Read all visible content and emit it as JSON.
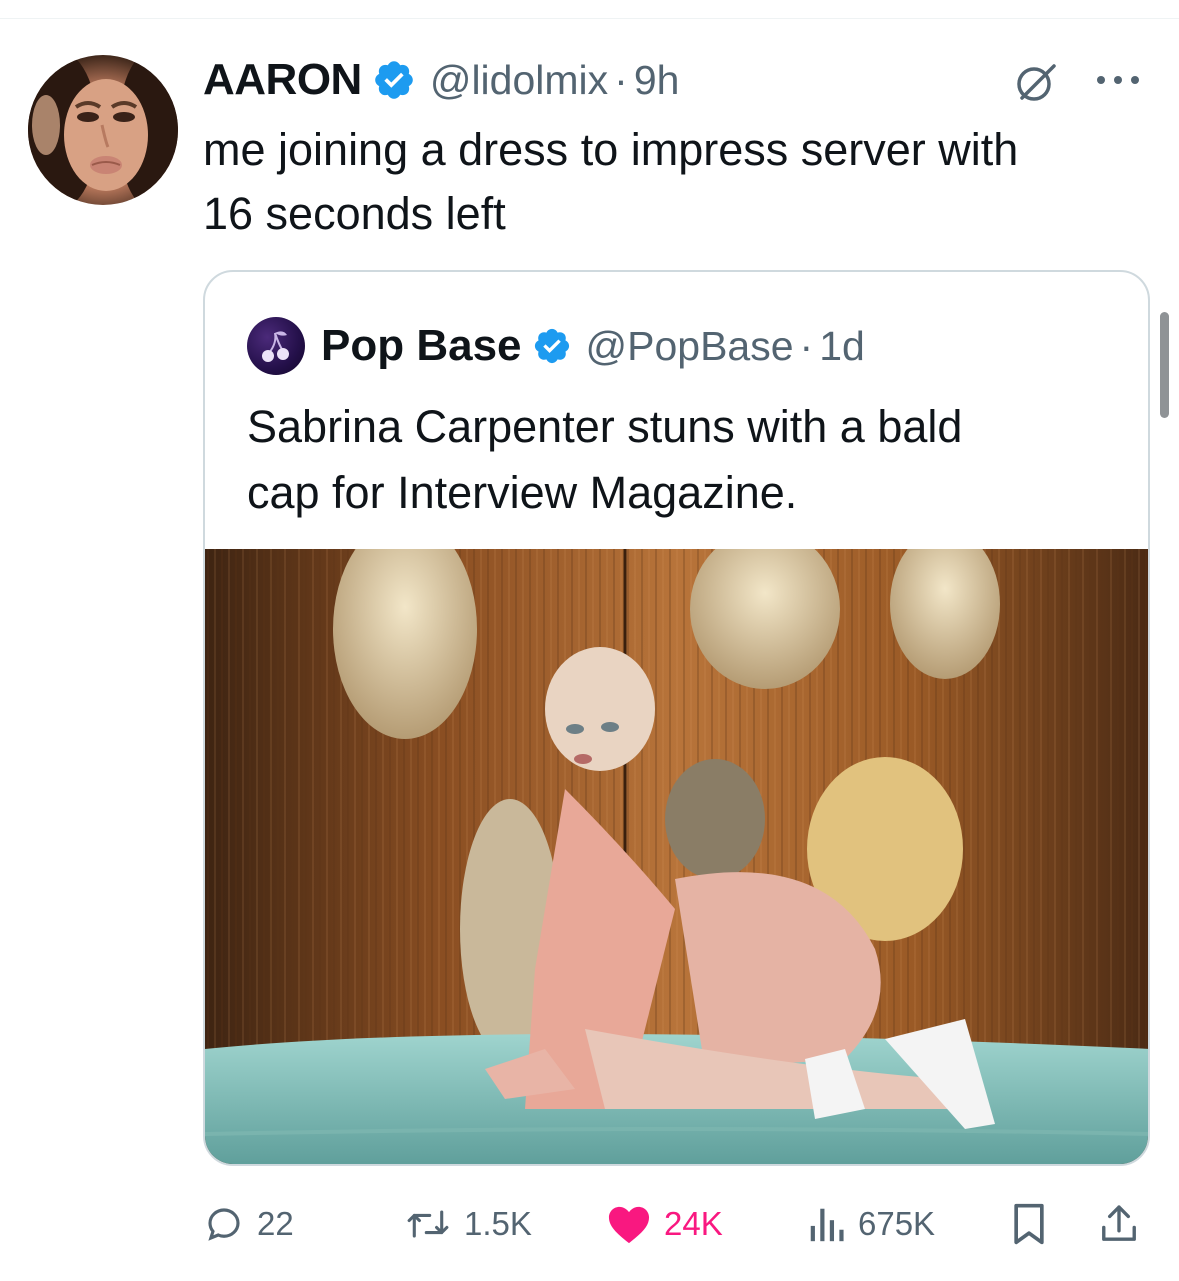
{
  "tweet": {
    "display_name": "AARON",
    "handle": "@lidolmix",
    "separator": "·",
    "time": "9h",
    "text_lines": [
      "me joining a dress to impress server with",
      "16 seconds left"
    ]
  },
  "quote": {
    "display_name": "Pop Base",
    "handle": "@PopBase",
    "separator": "·",
    "time": "1d",
    "text_lines": [
      "Sabrina Carpenter stuns with a bald",
      "cap for Interview Magazine."
    ]
  },
  "actions": {
    "replies": "22",
    "reposts": "1.5K",
    "likes": "24K",
    "views": "675K"
  },
  "icons": {
    "verified": "verified-badge-icon",
    "grok": "grok-icon",
    "more": "more-icon",
    "reply": "reply-icon",
    "repost": "repost-icon",
    "like": "heart-icon",
    "views": "views-icon",
    "bookmark": "bookmark-icon",
    "share": "share-icon"
  },
  "colors": {
    "verified": "#1d9bf0",
    "like": "#f91880",
    "muted": "#536471",
    "text": "#0f1419",
    "border": "#cfd9de"
  }
}
